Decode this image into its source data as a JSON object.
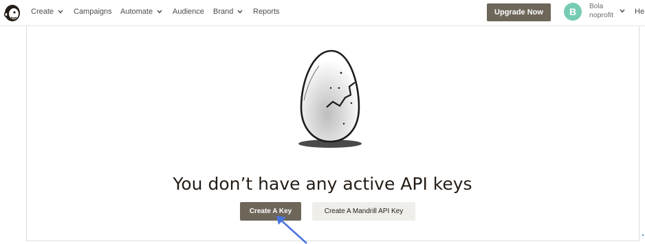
{
  "nav": {
    "items": [
      {
        "label": "Create",
        "has_dropdown": true
      },
      {
        "label": "Campaigns",
        "has_dropdown": false
      },
      {
        "label": "Automate",
        "has_dropdown": true
      },
      {
        "label": "Audience",
        "has_dropdown": false
      },
      {
        "label": "Brand",
        "has_dropdown": true
      },
      {
        "label": "Reports",
        "has_dropdown": false
      }
    ],
    "upgrade_label": "Upgrade Now",
    "account": {
      "avatar_initial": "B",
      "name": "Bola",
      "org": "noprofit"
    },
    "help_label": "He"
  },
  "empty_state": {
    "title": "You don’t have any active API keys",
    "primary_button": "Create A Key",
    "secondary_button": "Create A Mandrill API Key"
  },
  "colors": {
    "primary_button": "#6d6659",
    "secondary_button": "#efeeea",
    "avatar": "#77cbb4",
    "annotation_arrow": "#4a74e0"
  },
  "icons": [
    "mailchimp-logo-icon",
    "chevron-down-icon",
    "cracked-egg-illustration",
    "annotation-arrow-icon"
  ]
}
